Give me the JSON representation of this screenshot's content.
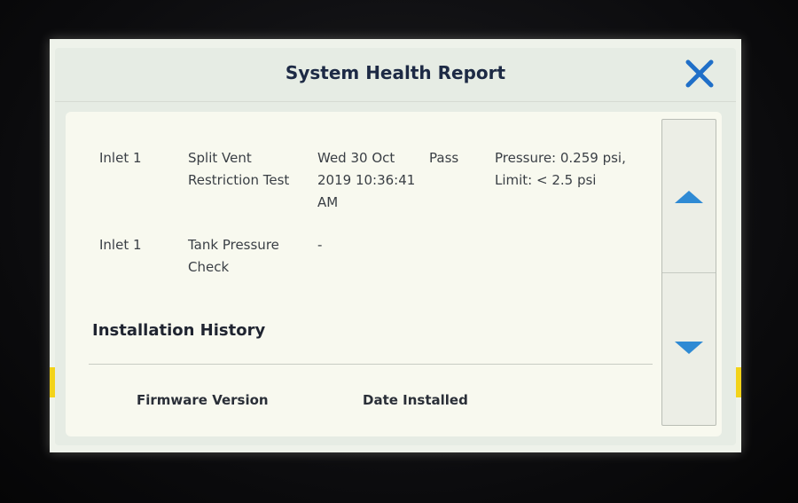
{
  "dialog": {
    "title": "System Health Report",
    "close_icon": "close-x-icon"
  },
  "results": [
    {
      "location": "Inlet 1",
      "test": [
        "Split Vent",
        "Restriction Test"
      ],
      "timestamp": [
        "Wed 30 Oct",
        "2019 10:36:41",
        "AM"
      ],
      "status": "Pass",
      "details": [
        "Pressure: 0.259 psi,",
        "Limit: < 2.5 psi"
      ]
    },
    {
      "location": "Inlet 1",
      "test": [
        "Tank Pressure",
        "Check"
      ],
      "timestamp": [
        "-"
      ],
      "status": "",
      "details": []
    }
  ],
  "installation_history": {
    "title": "Installation History",
    "columns": [
      "Firmware Version",
      "Date Installed"
    ]
  },
  "scrollbar": {
    "up_icon": "triangle-up-icon",
    "down_icon": "triangle-down-icon"
  },
  "colors": {
    "accent": "#2f8ad4",
    "title": "#1d2a45",
    "indicator": "#f3d31a"
  }
}
